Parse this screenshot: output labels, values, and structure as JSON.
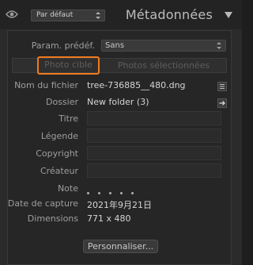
{
  "header": {
    "preset_value": "Par défaut",
    "title": "Métadonnées"
  },
  "preset_row": {
    "label": "Param. prédéf.",
    "value": "Sans"
  },
  "tabs": [
    {
      "label": "Photo cible",
      "highlighted": true
    },
    {
      "label": "Photos sélectionnées",
      "highlighted": false
    }
  ],
  "fields": {
    "filename": {
      "label": "Nom du fichier",
      "value": "tree-736885__480.dng"
    },
    "folder": {
      "label": "Dossier",
      "value": "New folder (3)"
    },
    "title": {
      "label": "Titre",
      "value": ""
    },
    "caption": {
      "label": "Légende",
      "value": ""
    },
    "copyright": {
      "label": "Copyright",
      "value": ""
    },
    "creator": {
      "label": "Créateur",
      "value": ""
    },
    "rating": {
      "label": "Note",
      "stars": 0,
      "max": 5
    },
    "capture_date": {
      "label": "Date de capture",
      "value": "2021年9月21日"
    },
    "dimensions": {
      "label": "Dimensions",
      "value": "771 x 480"
    }
  },
  "customize_label": "Personnaliser...",
  "colors": {
    "highlight": "#f07a1c",
    "panel_bg": "#2b2b2b"
  },
  "icons": [
    "eye-icon",
    "select-arrows-icon",
    "collapse-triangle-icon",
    "list-icon",
    "arrow-right-icon"
  ]
}
